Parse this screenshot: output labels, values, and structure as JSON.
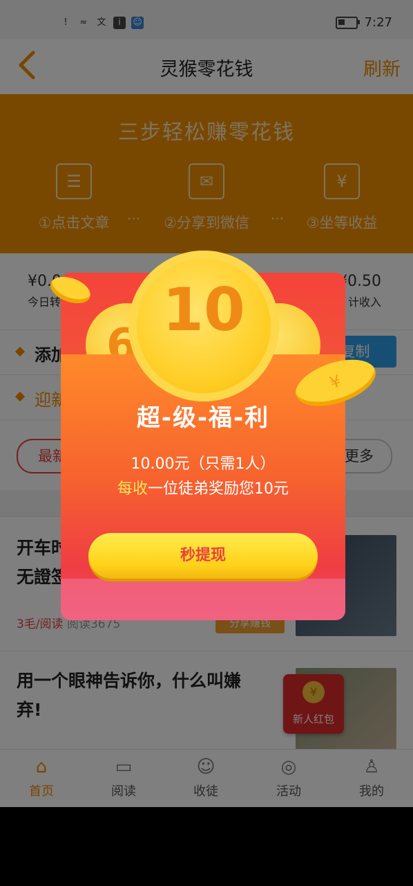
{
  "status_bar": {
    "time": "7:27",
    "icons": [
      "alert-icon",
      "wifi-icon",
      "wen-icon",
      "info-icon",
      "app-icon",
      "battery-icon"
    ]
  },
  "nav": {
    "title": "灵猴零花钱",
    "refresh": "刷新"
  },
  "banner": {
    "title": "三步轻松赚零花钱",
    "steps": [
      {
        "label": "①点击文章",
        "icon": "list-icon"
      },
      {
        "label": "②分享到微信",
        "icon": "wechat-icon"
      },
      {
        "label": "③坐等收益",
        "icon": "yen-icon"
      }
    ],
    "separator": "···"
  },
  "stats": {
    "today_value": "¥0.0",
    "today_label": "今日转",
    "total_value": "¥0.50",
    "total_label": "计收入"
  },
  "rows": {
    "add_text": "添加",
    "welcome_text": "迎新",
    "copy_button": "击复制"
  },
  "tabs": {
    "latest": "最新",
    "more": "更多"
  },
  "articles": [
    {
      "title": "开车时\n无證签",
      "price": "3毛/阅读",
      "reads": "阅读3675",
      "share": "分享赚钱"
    },
    {
      "title": "用一个眼神告诉你，什么叫嫌\n弃!"
    }
  ],
  "newbie_badge": {
    "coin": "¥",
    "label": "新人红包"
  },
  "popup": {
    "coin_value": "10",
    "side_coin_value": "6",
    "flat_coin_symbol": "¥",
    "title": "超-级-福-利",
    "line1": "10.00元（只需1人）",
    "line2_highlight": "每收",
    "line2_rest": "一位徒弟奖励您10元",
    "button": "秒提现"
  },
  "bottom_nav": [
    {
      "label": "首页",
      "icon": "home-icon",
      "active": true
    },
    {
      "label": "阅读",
      "icon": "book-icon",
      "active": false
    },
    {
      "label": "收徒",
      "icon": "user-add-icon",
      "active": false
    },
    {
      "label": "活动",
      "icon": "compass-icon",
      "active": false
    },
    {
      "label": "我的",
      "icon": "person-icon",
      "active": false
    }
  ],
  "colors": {
    "accent": "#f08c00",
    "banner": "#f29100",
    "red": "#e8413e"
  }
}
